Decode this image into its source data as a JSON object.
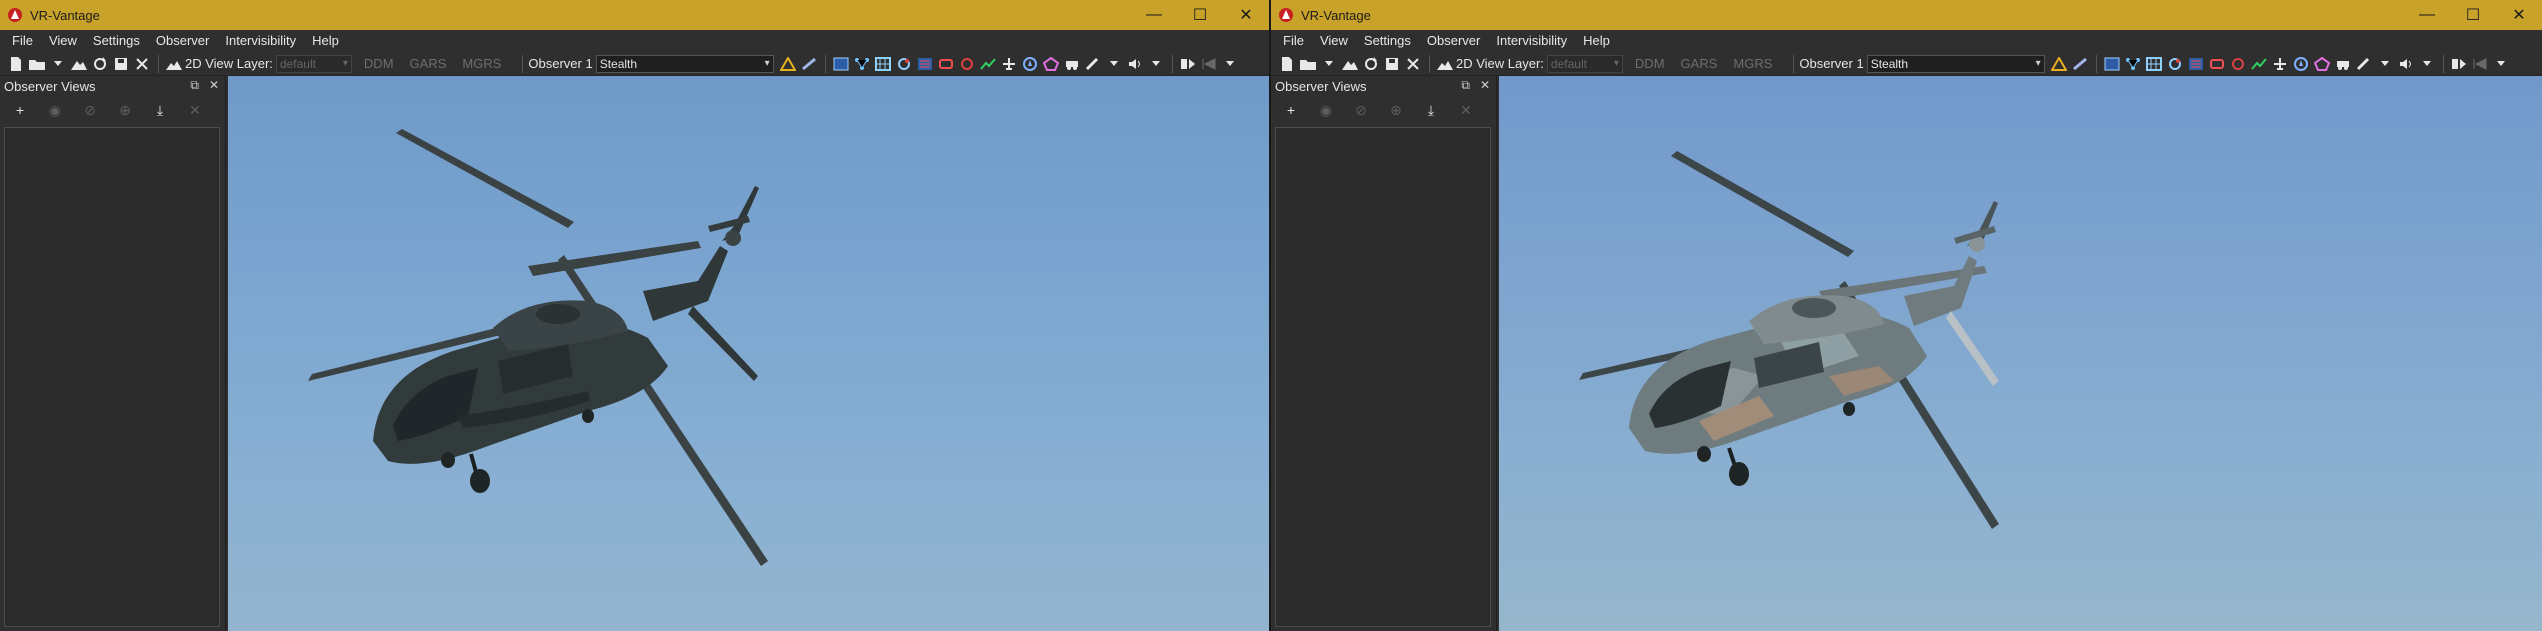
{
  "windows": [
    {
      "title": "VR-Vantage",
      "controls": {
        "minimize": "—",
        "maximize": "☐",
        "close": "✕"
      },
      "menu": [
        "File",
        "View",
        "Settings",
        "Observer",
        "Intervisibility",
        "Help"
      ],
      "toolbar": {
        "view_layer_label": "2D View Layer:",
        "view_layer_value": "default",
        "coord_buttons": [
          "DDM",
          "GARS",
          "MGRS"
        ],
        "observer_label": "Observer 1",
        "observer_value": "Stealth"
      },
      "panel": {
        "title": "Observer Views",
        "float_icon": "⧉",
        "close_icon": "✕"
      },
      "helicopter_style": "dark"
    },
    {
      "title": "VR-Vantage",
      "controls": {
        "minimize": "—",
        "maximize": "☐",
        "close": "✕"
      },
      "menu": [
        "File",
        "View",
        "Settings",
        "Observer",
        "Intervisibility",
        "Help"
      ],
      "toolbar": {
        "view_layer_label": "2D View Layer:",
        "view_layer_value": "default",
        "coord_buttons": [
          "DDM",
          "GARS",
          "MGRS"
        ],
        "observer_label": "Observer 1",
        "observer_value": "Stealth"
      },
      "panel": {
        "title": "Observer Views",
        "float_icon": "⧉",
        "close_icon": "✕"
      },
      "helicopter_style": "camo"
    }
  ],
  "colors": {
    "titlebar": "#c9a22a",
    "chrome": "#2f2f2f",
    "sky_top": "#6f99c8",
    "sky_bottom": "#93b5cf",
    "heli_dark": "#2e3536",
    "heli_camo": "#6f7d80"
  },
  "icons": {
    "app": "vr-vantage-logo-icon",
    "panel_tools": [
      "add-icon",
      "eye-icon",
      "hide-icon",
      "target-icon",
      "download-icon",
      "clear-icon"
    ]
  }
}
